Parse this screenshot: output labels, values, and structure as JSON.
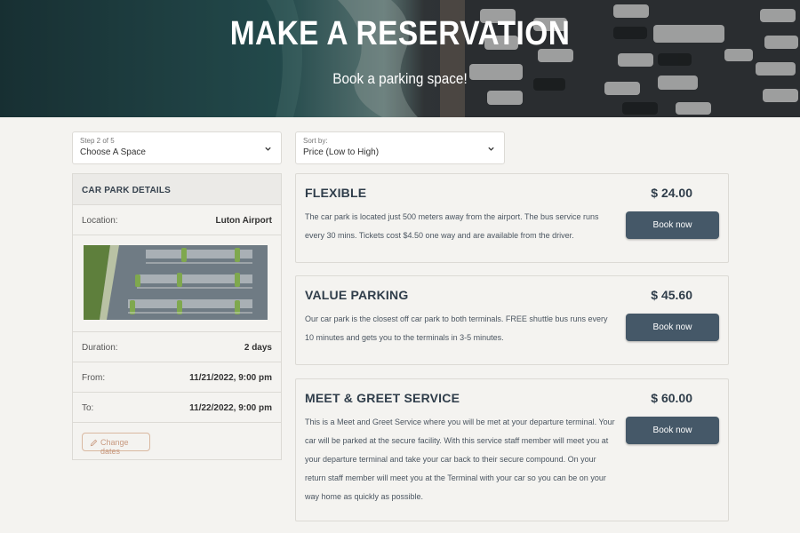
{
  "hero": {
    "title": "MAKE A RESERVATION",
    "subtitle": "Book a parking space!"
  },
  "step_select": {
    "label": "Step 2 of 5",
    "value": "Choose A Space"
  },
  "sort_select": {
    "label": "Sort by:",
    "value": "Price (Low to High)"
  },
  "details": {
    "header": "CAR PARK DETAILS",
    "location_label": "Location:",
    "location_value": "Luton Airport",
    "duration_label": "Duration:",
    "duration_value": "2 days",
    "from_label": "From:",
    "from_value": "11/21/2022, 9:00 pm",
    "to_label": "To:",
    "to_value": "11/22/2022, 9:00 pm",
    "change_label": "Change dates"
  },
  "options": [
    {
      "title": "FLEXIBLE",
      "price": "$ 24.00",
      "description": "The car park is located just 500 meters away from the airport. The bus service runs every 30 mins. Tickets cost $4.50 one way and are available from the driver.",
      "button": "Book now"
    },
    {
      "title": "VALUE PARKING",
      "price": "$ 45.60",
      "description": "Our car park is the closest off car park to both terminals. FREE shuttle bus runs every 10 minutes and gets you to the terminals in 3-5 minutes.",
      "button": "Book now"
    },
    {
      "title": "MEET & GREET SERVICE",
      "price": "$ 60.00",
      "description": "This is a Meet and Greet Service where you will be met at your departure terminal. Your car will be parked at the secure facility. With this service staff member will meet you at your departure terminal and take your car back to their secure compound. On your return staff member will meet you at the Terminal with your car so you can be on your way home as quickly as possible.",
      "button": "Book now"
    }
  ],
  "colors": {
    "page_bg": "#f4f3f0",
    "button_bg": "#455868",
    "title_text": "#2f3d4a",
    "accent_outline": "#d9b8a0"
  }
}
